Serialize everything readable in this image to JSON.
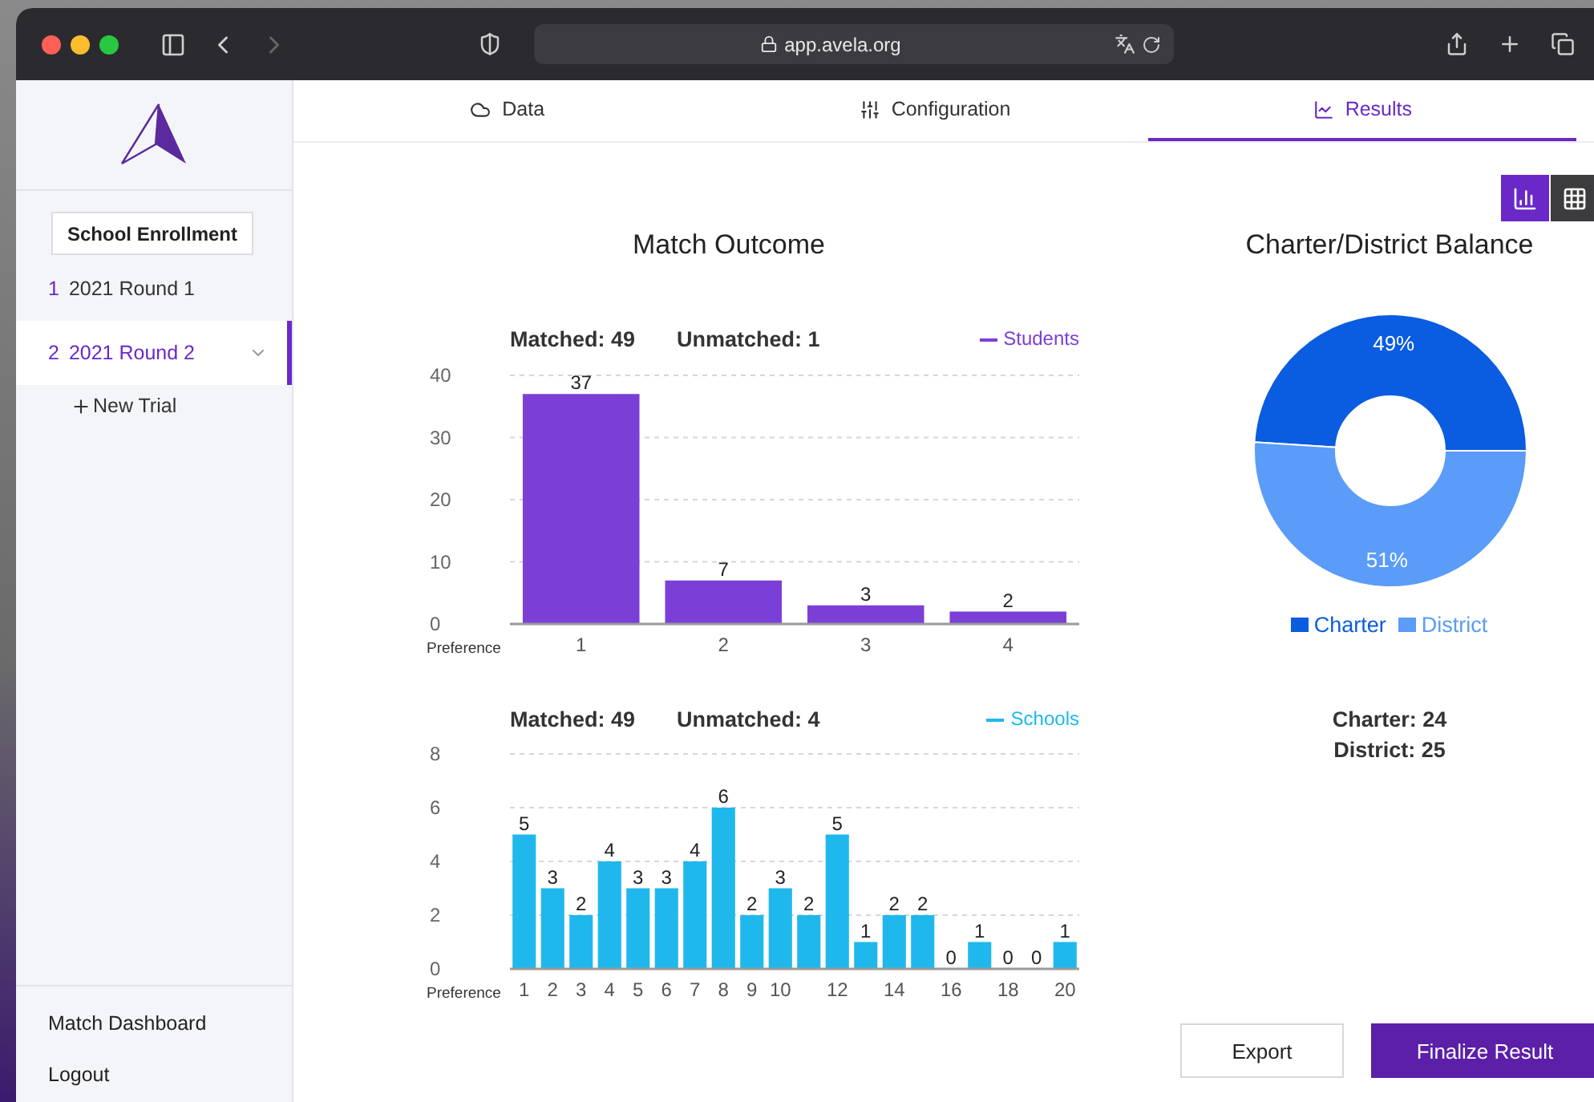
{
  "browser": {
    "url": "app.avela.org"
  },
  "sidebar": {
    "project_button": "School Enrollment",
    "rounds": [
      {
        "number": "1",
        "label": "2021 Round 1",
        "selected": false
      },
      {
        "number": "2",
        "label": "2021 Round 2",
        "selected": true
      }
    ],
    "new_trial": "New Trial",
    "bottom_links": [
      "Match Dashboard",
      "Logout"
    ]
  },
  "tabs": [
    {
      "label": "Data",
      "selected": false
    },
    {
      "label": "Configuration",
      "selected": false
    },
    {
      "label": "Results",
      "selected": true
    }
  ],
  "view_toggle": [
    {
      "kind": "chart",
      "selected": true
    },
    {
      "kind": "table",
      "selected": false
    }
  ],
  "match_outcome": {
    "title": "Match Outcome",
    "charts": [
      {
        "matched": "Matched: 49",
        "unmatched": "Unmatched: 1",
        "chart_data": {
          "type": "bar",
          "xlabel": "Preference",
          "categories": [
            "1",
            "2",
            "3",
            "4"
          ],
          "series": [
            {
              "name": "Students",
              "color": "#7b3fd8",
              "values": [
                37,
                7,
                3,
                2
              ]
            }
          ],
          "ylim": [
            0,
            40
          ],
          "yticks": [
            0,
            10,
            20,
            30,
            40
          ],
          "grid": true,
          "data_labels": true
        }
      },
      {
        "matched": "Matched: 49",
        "unmatched": "Unmatched: 4",
        "chart_data": {
          "type": "bar",
          "xlabel": "Preference",
          "x": [
            1,
            2,
            3,
            4,
            5,
            6,
            7,
            8,
            9,
            10,
            11,
            12,
            13,
            14,
            15,
            16,
            17,
            18,
            19,
            20
          ],
          "xlim": [
            0.5,
            20.5
          ],
          "xticks": [
            1,
            2,
            3,
            4,
            5,
            6,
            7,
            8,
            9,
            10,
            12,
            14,
            16,
            18,
            20
          ],
          "series": [
            {
              "name": "Schools",
              "color": "#1fb8ec",
              "values": [
                5,
                3,
                2,
                4,
                3,
                3,
                4,
                6,
                2,
                3,
                2,
                5,
                1,
                2,
                2,
                0,
                1,
                0,
                0,
                1
              ]
            }
          ],
          "ylim": [
            0,
            8
          ],
          "yticks": [
            0,
            2,
            4,
            6,
            8
          ],
          "grid": true,
          "data_labels": true
        }
      }
    ]
  },
  "balance": {
    "title": "Charter/District Balance",
    "chart_data": {
      "type": "donut",
      "categories": [
        "Charter",
        "District"
      ],
      "values": [
        49,
        51
      ],
      "colors": [
        "#0a5ce0",
        "#5a9cf8"
      ],
      "value_labels": [
        "49%",
        "51%"
      ]
    },
    "totals": [
      "Charter: 24",
      "District: 25"
    ]
  },
  "buttons": [
    {
      "label": "Export",
      "kind": "secondary"
    },
    {
      "label": "Finalize Result",
      "kind": "primary"
    }
  ]
}
